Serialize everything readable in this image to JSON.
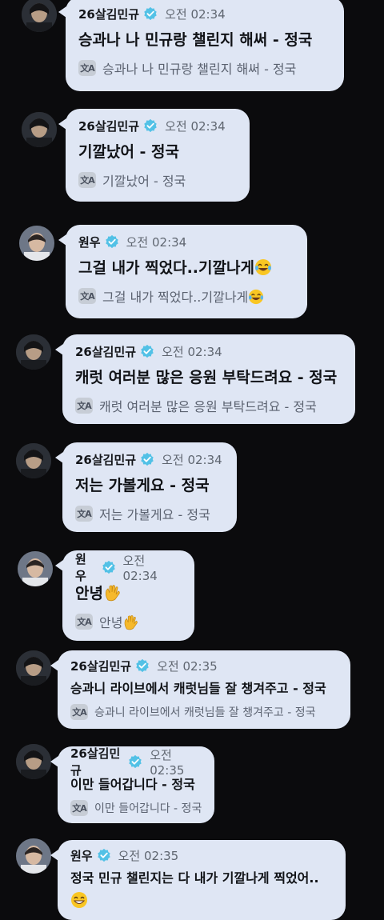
{
  "messages": [
    {
      "sender": "26살김민규",
      "time": "오전 02:34",
      "text": "승과나 나 민규랑 챌린지 해써 - 정국",
      "translation": "승과나 나 민규랑 챌린지 해써 - 정국"
    },
    {
      "sender": "26살김민규",
      "time": "오전 02:34",
      "text": "기깔났어 - 정국",
      "translation": "기깔났어 - 정국"
    },
    {
      "sender": "원우",
      "time": "오전 02:34",
      "text": "그걸 내가 찍었다..기깔나게",
      "translation": "그걸 내가 찍었다..기깔나게",
      "emoji": "tears-of-joy-emoji"
    },
    {
      "sender": "26살김민규",
      "time": "오전 02:34",
      "text": "캐럿 여러분 많은 응원 부탁드려요 - 정국",
      "translation": "캐럿 여러분 많은 응원 부탁드려요 - 정국"
    },
    {
      "sender": "26살김민규",
      "time": "오전 02:34",
      "text": "저는 가볼게요 - 정국",
      "translation": "저는 가볼게요 - 정국"
    },
    {
      "sender": "원우",
      "time": "오전 02:34",
      "text": "안녕",
      "translation": "안녕",
      "emoji": "waving-hand-emoji"
    },
    {
      "sender": "26살김민규",
      "time": "오전 02:35",
      "text": "승과니 라이브에서 캐럿님들 잘 챙겨주고 - 정국",
      "translation": "승과니 라이브에서 캐럿님들 잘 챙겨주고 - 정국"
    },
    {
      "sender": "26살김민규",
      "time": "오전 02:35",
      "text": "이만 들어갑니다 - 정국",
      "translation": "이만 들어갑니다 - 정국"
    },
    {
      "sender": "원우",
      "time": "오전 02:35",
      "text": "정국 민규 챌린지는 다 내가 기깔나게 찍었어..",
      "emoji": "grinning-emoji"
    }
  ],
  "icons": {
    "translate": "translate-icon",
    "verified": "verified-badge-icon"
  },
  "colors": {
    "background": "#0b0b0d",
    "bubble": "#dfe6f4",
    "verified": "#52c1e6"
  }
}
